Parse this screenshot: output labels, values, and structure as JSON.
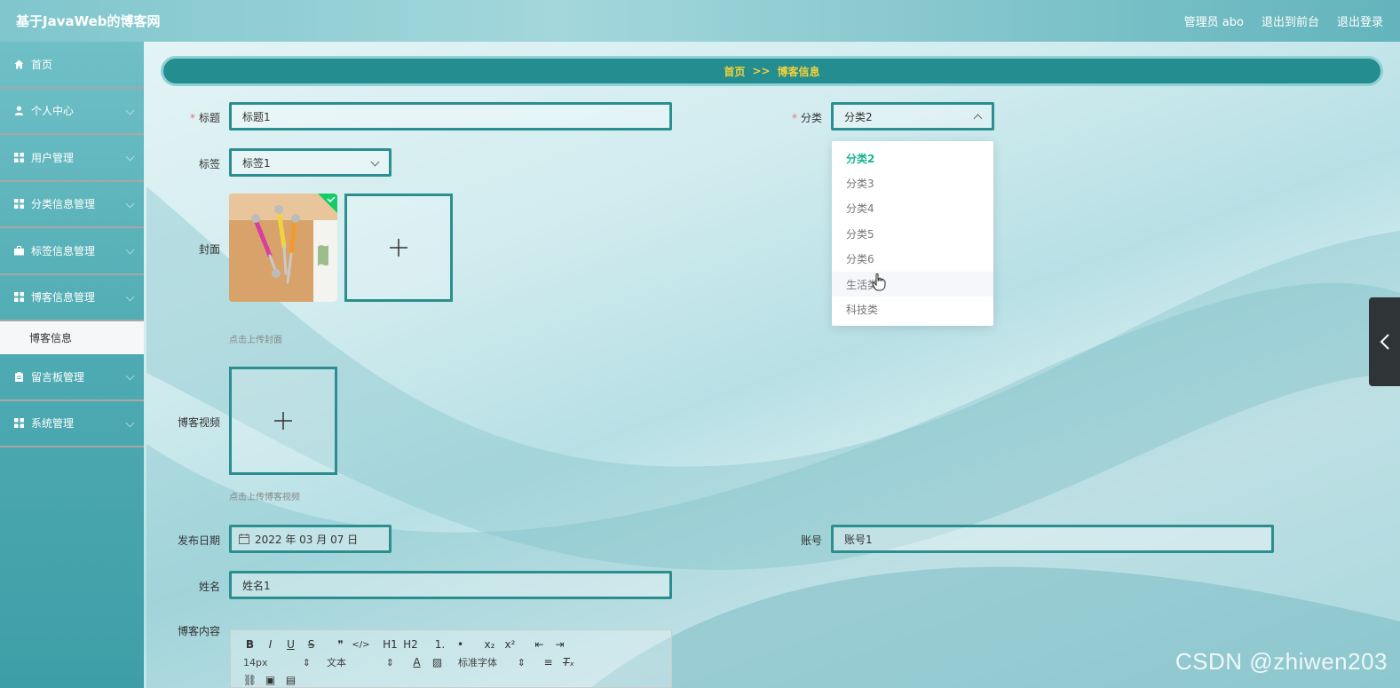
{
  "app": {
    "title": "基于JavaWeb的博客网"
  },
  "header": {
    "user_label": "管理员 abo",
    "front_label": "退出到前台",
    "logout_label": "退出登录"
  },
  "sidebar": {
    "items": [
      {
        "label": "首页",
        "icon": "home-icon"
      },
      {
        "label": "个人中心",
        "icon": "user-icon"
      },
      {
        "label": "用户管理",
        "icon": "grid-icon"
      },
      {
        "label": "分类信息管理",
        "icon": "grid-icon"
      },
      {
        "label": "标签信息管理",
        "icon": "briefcase-icon"
      },
      {
        "label": "博客信息管理",
        "icon": "grid-icon"
      },
      {
        "label": "留言板管理",
        "icon": "clipboard-icon"
      },
      {
        "label": "系统管理",
        "icon": "grid-icon"
      }
    ],
    "active_sub": "博客信息"
  },
  "breadcrumb": {
    "home": "首页",
    "sep": ">>",
    "current": "博客信息"
  },
  "form": {
    "title_label": "标题",
    "title_value": "标题1",
    "category_label": "分类",
    "category_value": "分类2",
    "tag_label": "标签",
    "tag_value": "标签1",
    "cover_label": "封面",
    "cover_hint": "点击上传封面",
    "video_label": "博客视频",
    "video_hint": "点击上传博客视频",
    "date_label": "发布日期",
    "date_value": "2022 年 03 月 07 日",
    "account_label": "账号",
    "account_value": "账号1",
    "name_label": "姓名",
    "name_value": "姓名1",
    "content_label": "博客内容"
  },
  "category_options": [
    "分类2",
    "分类3",
    "分类4",
    "分类5",
    "分类6",
    "生活类",
    "科技类"
  ],
  "editor": {
    "row1": [
      "B",
      "I",
      "U",
      "S",
      "❞",
      "</>",
      "H1",
      "H2",
      "1.",
      "•",
      "x₂",
      "x²",
      "⇤",
      "⇥"
    ],
    "font_size": "14px",
    "block_type": "文本",
    "font_family": "标准字体"
  },
  "watermark": "CSDN @zhiwen203",
  "colors": {
    "accent": "#2b8e8f",
    "breadcrumb_bg": "#248d90",
    "breadcrumb_text": "#f3d23a",
    "selected_option": "#1ab394"
  }
}
